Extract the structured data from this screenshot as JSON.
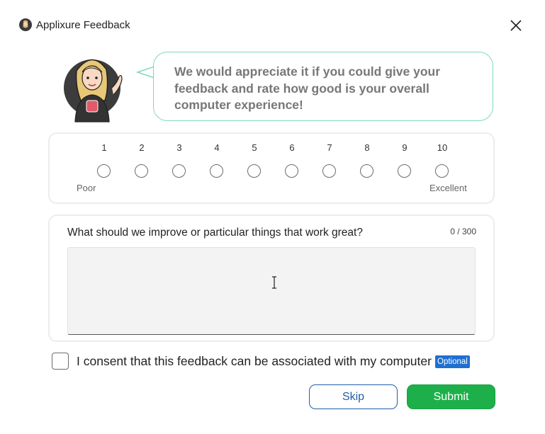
{
  "window": {
    "title": "Applixure Feedback",
    "app_icon": "avatar-icon",
    "close_icon": "close-icon"
  },
  "prompt": {
    "text": "We would appreciate it if you could give your feedback and rate how good is your overall computer experience!",
    "accent_color": "#7fd8c3"
  },
  "rating": {
    "scale": [
      "1",
      "2",
      "3",
      "4",
      "5",
      "6",
      "7",
      "8",
      "9",
      "10"
    ],
    "selected": null,
    "low_label": "Poor",
    "high_label": "Excellent"
  },
  "feedback": {
    "question": "What should we improve or particular things that work great?",
    "counter": "0 / 300",
    "value": ""
  },
  "consent": {
    "checked": false,
    "label": "I consent that this feedback can be associated with my computer",
    "badge": "Optional",
    "badge_color": "#1f6fd1"
  },
  "actions": {
    "skip_label": "Skip",
    "submit_label": "Submit",
    "submit_color": "#1db04a"
  }
}
